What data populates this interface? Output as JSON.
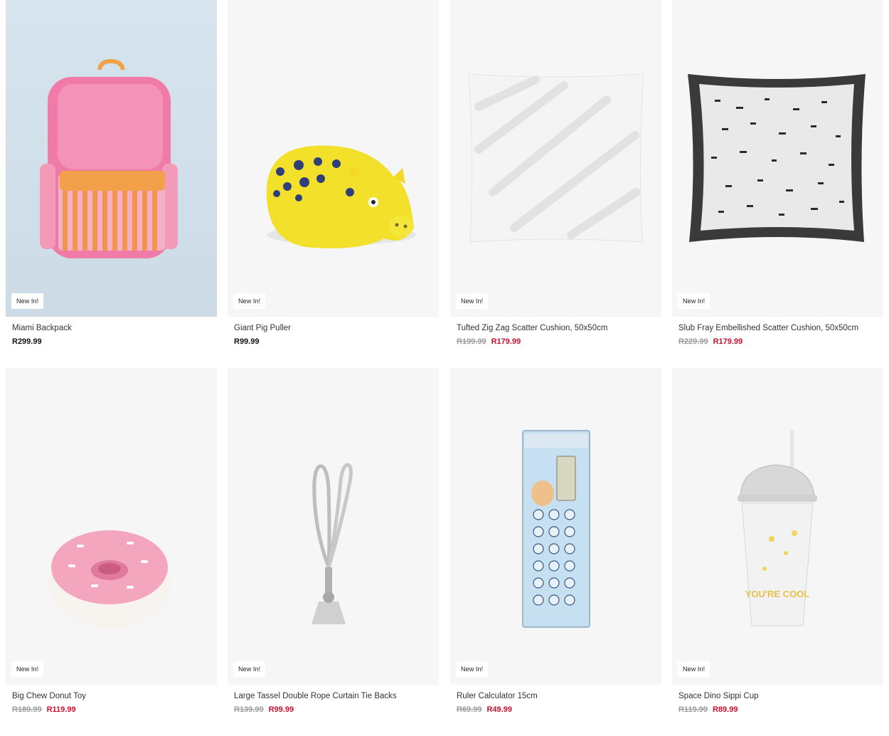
{
  "products": [
    {
      "name": "Miami Backpack",
      "badge": "New In!",
      "price": "R299.99",
      "icon": "backpack"
    },
    {
      "name": "Giant Pig Puller",
      "badge": "New In!",
      "price": "R99.99",
      "icon": "pig-toy"
    },
    {
      "name": "Tufted Zig Zag Scatter Cushion, 50x50cm",
      "badge": "New In!",
      "was_price": "R199.99",
      "sale_price": "R179.99",
      "icon": "white-cushion"
    },
    {
      "name": "Slub Fray Embellished Scatter Cushion, 50x50cm",
      "badge": "New In!",
      "was_price": "R229.99",
      "sale_price": "R179.99",
      "icon": "speckled-cushion"
    },
    {
      "name": "Big Chew Donut Toy",
      "badge": "New In!",
      "was_price": "R189.99",
      "sale_price": "R119.99",
      "icon": "donut-toy"
    },
    {
      "name": "Large Tassel Double Rope Curtain Tie Backs",
      "badge": "New In!",
      "was_price": "R139.99",
      "sale_price": "R99.99",
      "icon": "tassel"
    },
    {
      "name": "Ruler Calculator 15cm",
      "badge": "New In!",
      "was_price": "R69.99",
      "sale_price": "R49.99",
      "icon": "ruler-calculator"
    },
    {
      "name": "Space Dino Sippi Cup",
      "badge": "New In!",
      "was_price": "R119.99",
      "sale_price": "R89.99",
      "icon": "sippy-cup",
      "cup_text": "YOU'RE COOL"
    }
  ],
  "colors": {
    "sale": "#c8102e",
    "was": "#9a9a9a",
    "badge_bg": "#ffffff",
    "card_bg": "#f6f6f6"
  }
}
